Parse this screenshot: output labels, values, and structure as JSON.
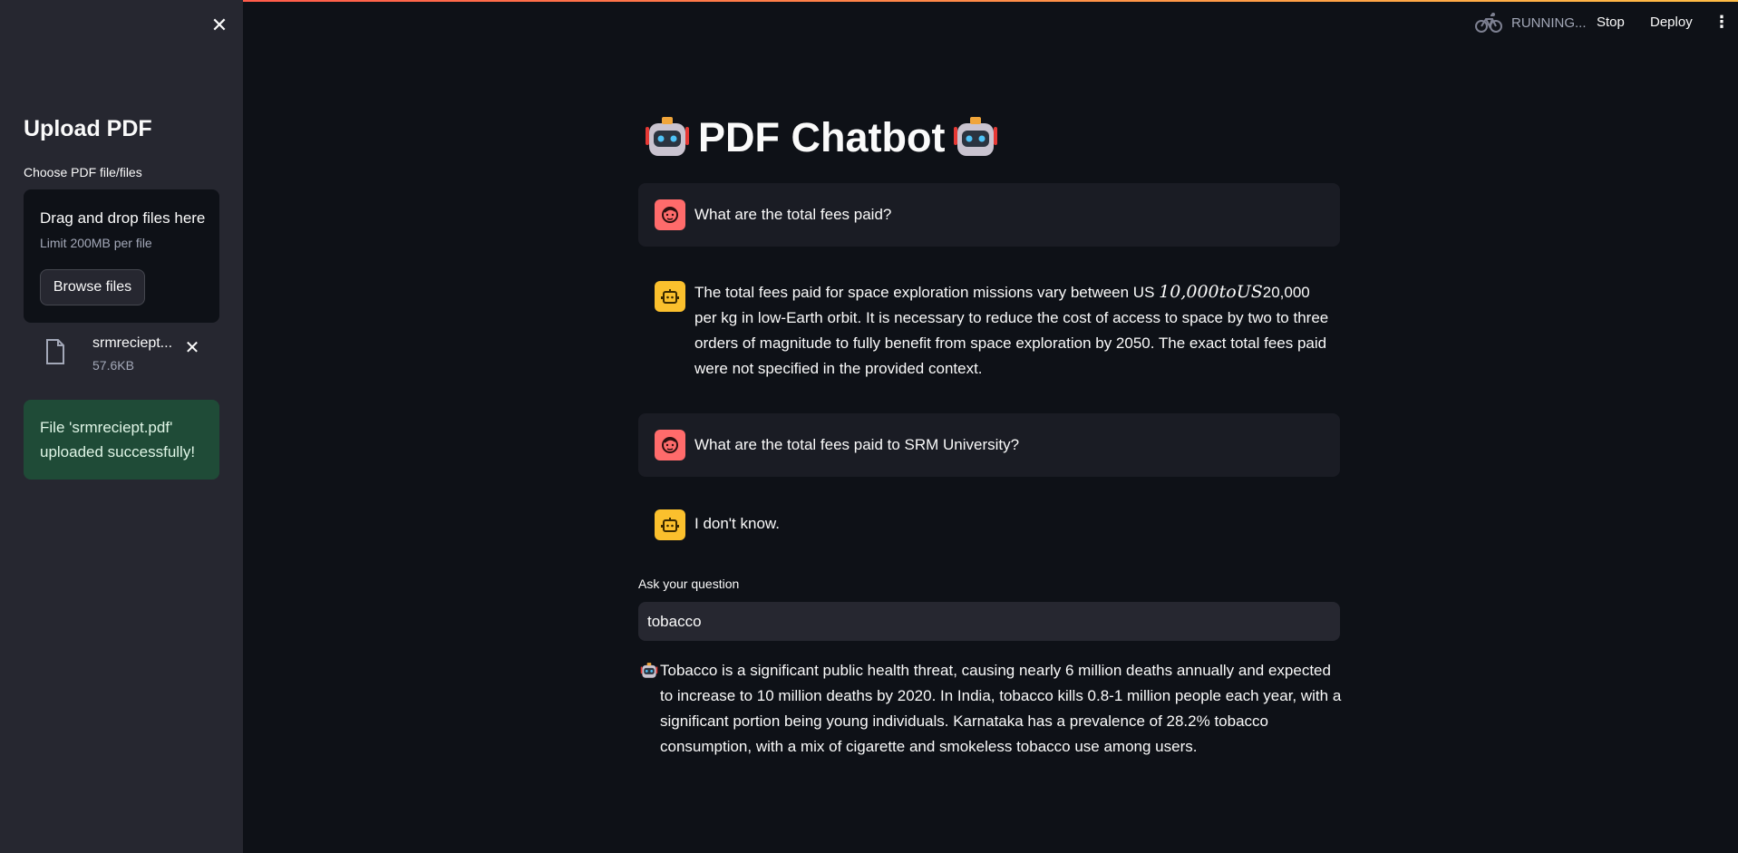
{
  "sidebar": {
    "close_icon": "close-icon",
    "title": "Upload PDF",
    "uploader_label": "Choose PDF file/files",
    "dropzone_title": "Drag and drop files here",
    "dropzone_limit": "Limit 200MB per file",
    "browse_label": "Browse files",
    "file": {
      "name": "srmreciept...",
      "size": "57.6KB"
    },
    "success_message": "File 'srmreciept.pdf' uploaded successfully!"
  },
  "header": {
    "status": "RUNNING...",
    "stop_label": "Stop",
    "deploy_label": "Deploy",
    "menu_icon": "⋮"
  },
  "main": {
    "title": "PDF Chatbot",
    "messages": [
      {
        "role": "user",
        "text": "What are the total fees paid?"
      },
      {
        "role": "bot",
        "text_before": "The total fees paid for space exploration missions vary between US ",
        "math": "10,000toUS",
        "text_after": "20,000 per kg in low-Earth orbit. It is necessary to reduce the cost of access to space by two to three orders of magnitude to fully benefit from space exploration by 2050. The exact total fees paid were not specified in the provided context."
      },
      {
        "role": "user",
        "text": "What are the total fees paid to SRM University?"
      },
      {
        "role": "bot",
        "text": "I don't know."
      }
    ],
    "question_label": "Ask your question",
    "question_value": "tobacco",
    "answer": "Tobacco is a significant public health threat, causing nearly 6 million deaths annually and expected to increase to 10 million deaths by 2020. In India, tobacco kills 0.8-1 million people each year, with a significant portion being young individuals. Karnataka has a prevalence of 28.2% tobacco consumption, with a mix of cigarette and smokeless tobacco use among users."
  },
  "colors": {
    "background": "#0e1117",
    "sidebar": "#262730",
    "user_avatar": "#ff6b6b",
    "bot_avatar": "#fbc02d",
    "success_bg": "#1f4b37"
  }
}
